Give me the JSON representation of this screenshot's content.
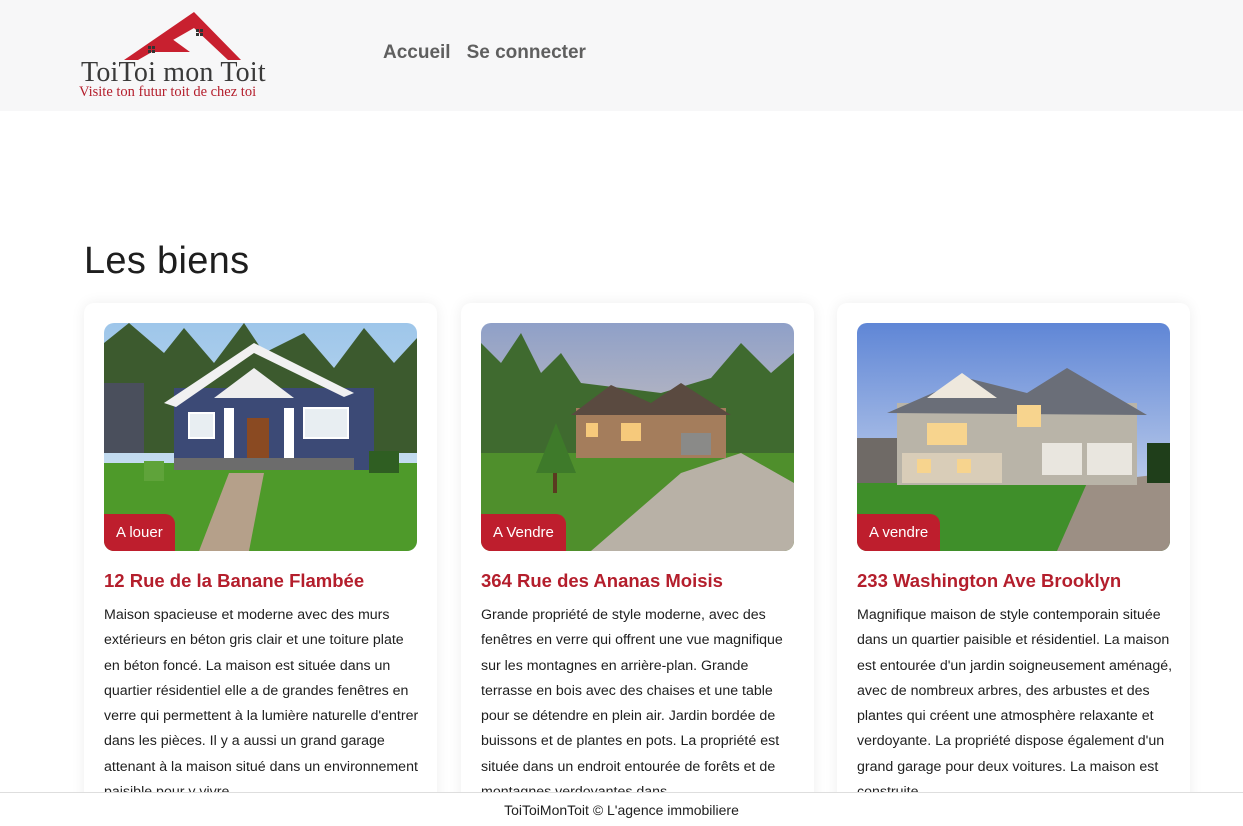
{
  "header": {
    "logo": {
      "brand": "ToiToi mon Toit",
      "slogan": "Visite ton futur toit de chez toi"
    },
    "nav": [
      {
        "label": "Accueil"
      },
      {
        "label": "Se connecter"
      }
    ]
  },
  "main": {
    "title": "Les biens",
    "cards": [
      {
        "badge": "A louer",
        "title": "12 Rue de la Banane Flambée",
        "description": "Maison spacieuse et moderne avec des murs extérieurs en béton gris clair et une toiture plate en béton foncé. La maison est située dans un quartier résidentiel elle a de grandes fenêtres en verre qui permettent à la lumière naturelle d'entrer dans les pièces. Il y a aussi un grand garage attenant à la maison situé dans un environnement paisible pour y vivre."
      },
      {
        "badge": "A Vendre",
        "title": "364 Rue des Ananas Moisis",
        "description": "Grande propriété de style moderne, avec des fenêtres en verre qui offrent une vue magnifique sur les montagnes en arrière-plan. Grande terrasse en bois avec des chaises et une table pour se détendre en plein air. Jardin bordée de buissons et de plantes en pots. La propriété est située dans un endroit entourée de forêts et de montagnes verdoyantes dans"
      },
      {
        "badge": "A vendre",
        "title": "233 Washington Ave Brooklyn",
        "description": "Magnifique maison de style contemporain située dans un quartier paisible et résidentiel. La maison est entourée d'un jardin soigneusement aménagé, avec de nombreux arbres, des arbustes et des plantes qui créent une atmosphère relaxante et verdoyante. La propriété dispose également d'un grand garage pour deux voitures. La maison est construite"
      }
    ]
  },
  "footer": {
    "text": "ToiToiMonToit © L'agence immobiliere"
  },
  "colors": {
    "accent": "#be1e2d",
    "header_bg": "#f7f7f8",
    "nav_text": "#5f5f5f"
  }
}
